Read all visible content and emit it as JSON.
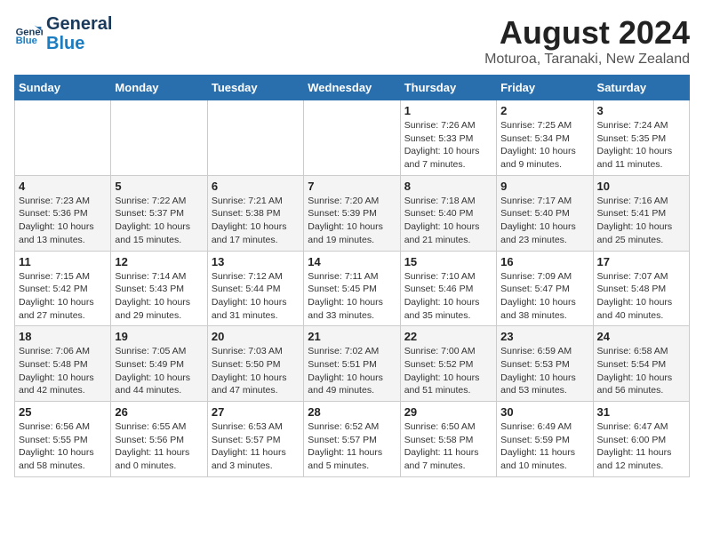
{
  "header": {
    "logo_line1": "General",
    "logo_line2": "Blue",
    "month": "August 2024",
    "location": "Moturoa, Taranaki, New Zealand"
  },
  "weekdays": [
    "Sunday",
    "Monday",
    "Tuesday",
    "Wednesday",
    "Thursday",
    "Friday",
    "Saturday"
  ],
  "weeks": [
    [
      {
        "day": "",
        "info": ""
      },
      {
        "day": "",
        "info": ""
      },
      {
        "day": "",
        "info": ""
      },
      {
        "day": "",
        "info": ""
      },
      {
        "day": "1",
        "info": "Sunrise: 7:26 AM\nSunset: 5:33 PM\nDaylight: 10 hours\nand 7 minutes."
      },
      {
        "day": "2",
        "info": "Sunrise: 7:25 AM\nSunset: 5:34 PM\nDaylight: 10 hours\nand 9 minutes."
      },
      {
        "day": "3",
        "info": "Sunrise: 7:24 AM\nSunset: 5:35 PM\nDaylight: 10 hours\nand 11 minutes."
      }
    ],
    [
      {
        "day": "4",
        "info": "Sunrise: 7:23 AM\nSunset: 5:36 PM\nDaylight: 10 hours\nand 13 minutes."
      },
      {
        "day": "5",
        "info": "Sunrise: 7:22 AM\nSunset: 5:37 PM\nDaylight: 10 hours\nand 15 minutes."
      },
      {
        "day": "6",
        "info": "Sunrise: 7:21 AM\nSunset: 5:38 PM\nDaylight: 10 hours\nand 17 minutes."
      },
      {
        "day": "7",
        "info": "Sunrise: 7:20 AM\nSunset: 5:39 PM\nDaylight: 10 hours\nand 19 minutes."
      },
      {
        "day": "8",
        "info": "Sunrise: 7:18 AM\nSunset: 5:40 PM\nDaylight: 10 hours\nand 21 minutes."
      },
      {
        "day": "9",
        "info": "Sunrise: 7:17 AM\nSunset: 5:40 PM\nDaylight: 10 hours\nand 23 minutes."
      },
      {
        "day": "10",
        "info": "Sunrise: 7:16 AM\nSunset: 5:41 PM\nDaylight: 10 hours\nand 25 minutes."
      }
    ],
    [
      {
        "day": "11",
        "info": "Sunrise: 7:15 AM\nSunset: 5:42 PM\nDaylight: 10 hours\nand 27 minutes."
      },
      {
        "day": "12",
        "info": "Sunrise: 7:14 AM\nSunset: 5:43 PM\nDaylight: 10 hours\nand 29 minutes."
      },
      {
        "day": "13",
        "info": "Sunrise: 7:12 AM\nSunset: 5:44 PM\nDaylight: 10 hours\nand 31 minutes."
      },
      {
        "day": "14",
        "info": "Sunrise: 7:11 AM\nSunset: 5:45 PM\nDaylight: 10 hours\nand 33 minutes."
      },
      {
        "day": "15",
        "info": "Sunrise: 7:10 AM\nSunset: 5:46 PM\nDaylight: 10 hours\nand 35 minutes."
      },
      {
        "day": "16",
        "info": "Sunrise: 7:09 AM\nSunset: 5:47 PM\nDaylight: 10 hours\nand 38 minutes."
      },
      {
        "day": "17",
        "info": "Sunrise: 7:07 AM\nSunset: 5:48 PM\nDaylight: 10 hours\nand 40 minutes."
      }
    ],
    [
      {
        "day": "18",
        "info": "Sunrise: 7:06 AM\nSunset: 5:48 PM\nDaylight: 10 hours\nand 42 minutes."
      },
      {
        "day": "19",
        "info": "Sunrise: 7:05 AM\nSunset: 5:49 PM\nDaylight: 10 hours\nand 44 minutes."
      },
      {
        "day": "20",
        "info": "Sunrise: 7:03 AM\nSunset: 5:50 PM\nDaylight: 10 hours\nand 47 minutes."
      },
      {
        "day": "21",
        "info": "Sunrise: 7:02 AM\nSunset: 5:51 PM\nDaylight: 10 hours\nand 49 minutes."
      },
      {
        "day": "22",
        "info": "Sunrise: 7:00 AM\nSunset: 5:52 PM\nDaylight: 10 hours\nand 51 minutes."
      },
      {
        "day": "23",
        "info": "Sunrise: 6:59 AM\nSunset: 5:53 PM\nDaylight: 10 hours\nand 53 minutes."
      },
      {
        "day": "24",
        "info": "Sunrise: 6:58 AM\nSunset: 5:54 PM\nDaylight: 10 hours\nand 56 minutes."
      }
    ],
    [
      {
        "day": "25",
        "info": "Sunrise: 6:56 AM\nSunset: 5:55 PM\nDaylight: 10 hours\nand 58 minutes."
      },
      {
        "day": "26",
        "info": "Sunrise: 6:55 AM\nSunset: 5:56 PM\nDaylight: 11 hours\nand 0 minutes."
      },
      {
        "day": "27",
        "info": "Sunrise: 6:53 AM\nSunset: 5:57 PM\nDaylight: 11 hours\nand 3 minutes."
      },
      {
        "day": "28",
        "info": "Sunrise: 6:52 AM\nSunset: 5:57 PM\nDaylight: 11 hours\nand 5 minutes."
      },
      {
        "day": "29",
        "info": "Sunrise: 6:50 AM\nSunset: 5:58 PM\nDaylight: 11 hours\nand 7 minutes."
      },
      {
        "day": "30",
        "info": "Sunrise: 6:49 AM\nSunset: 5:59 PM\nDaylight: 11 hours\nand 10 minutes."
      },
      {
        "day": "31",
        "info": "Sunrise: 6:47 AM\nSunset: 6:00 PM\nDaylight: 11 hours\nand 12 minutes."
      }
    ]
  ]
}
